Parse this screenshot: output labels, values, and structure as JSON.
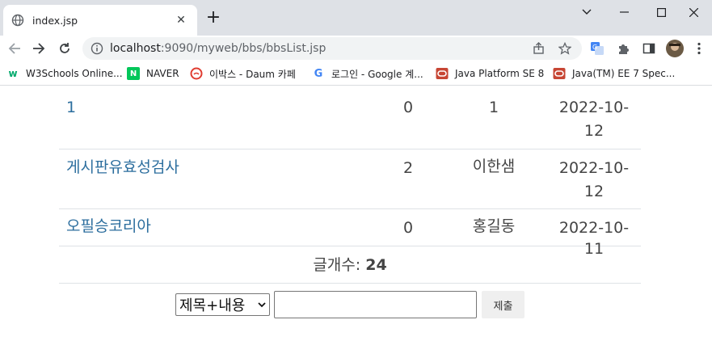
{
  "browser": {
    "tab_title": "index.jsp",
    "url_host": "localhost",
    "url_rest": ":9090/myweb/bbs/bbsList.jsp",
    "bookmarks": [
      {
        "label": "W3Schools Online...",
        "icon": "w3schools-icon",
        "color": "#04aa6d"
      },
      {
        "label": "NAVER",
        "icon": "naver-icon",
        "color": "#03c75a"
      },
      {
        "label": "이박스 - Daum 카페",
        "icon": "daum-cafe-icon",
        "color": "#e03c31"
      },
      {
        "label": "로그인 - Google 계...",
        "icon": "google-icon",
        "color": "#4285f4"
      },
      {
        "label": "Java Platform SE 8",
        "icon": "oracle-icon",
        "color": "#c74634"
      },
      {
        "label": "Java(TM) EE 7 Spec...",
        "icon": "oracle-icon",
        "color": "#c74634"
      }
    ]
  },
  "board": {
    "rows": [
      {
        "title": "1",
        "count": "0",
        "writer": "1",
        "date_line1": "2022-10-",
        "date_line2": "12"
      },
      {
        "title": "게시판유효성검사",
        "count": "2",
        "writer": "이한샘",
        "date_line1": "2022-10-",
        "date_line2": "12"
      },
      {
        "title": "오필승코리아",
        "count": "0",
        "writer": "홍길동",
        "date_line1": "2022-10-11",
        "date_line2": ""
      }
    ],
    "total_label": "글개수:",
    "total_value": "24"
  },
  "search": {
    "field_selected": "제목+내용",
    "keyword_value": "",
    "submit_label": "제출"
  }
}
